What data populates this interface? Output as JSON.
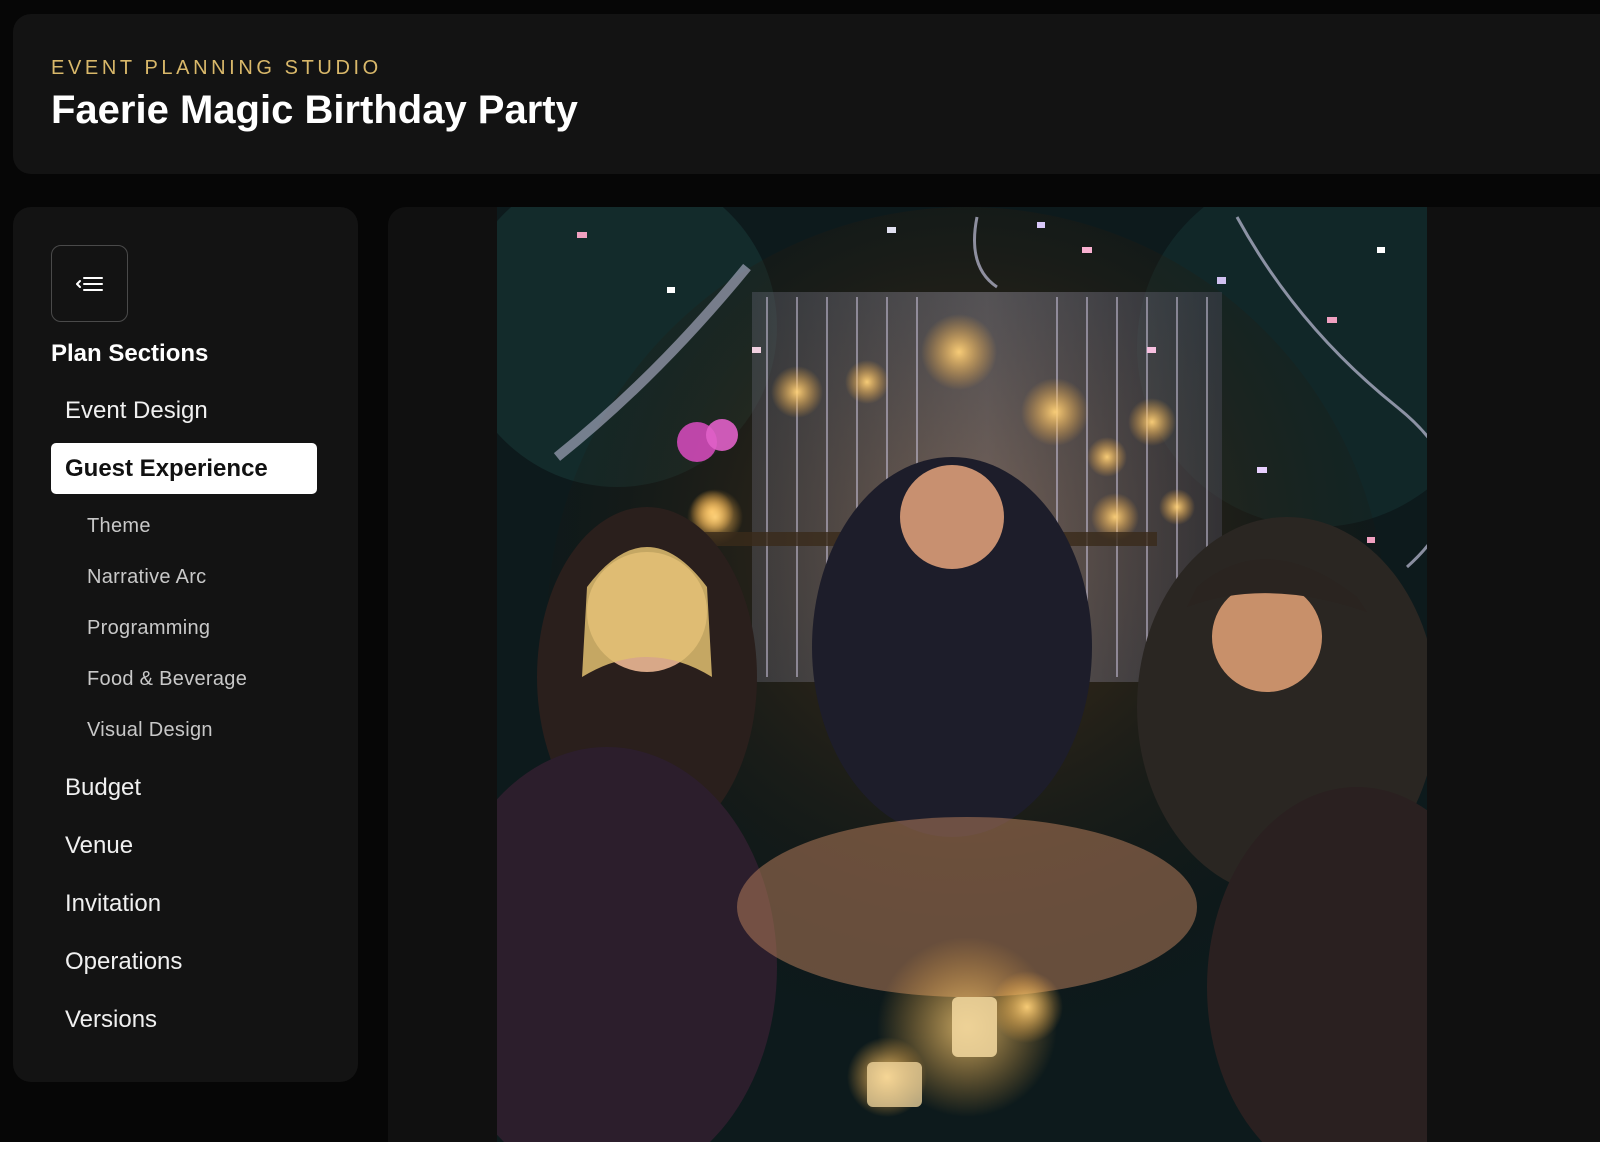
{
  "header": {
    "eyebrow": "EVENT PLANNING STUDIO",
    "title": "Faerie Magic Birthday Party"
  },
  "sidebar": {
    "toggle_icon": "collapse-menu-icon",
    "title": "Plan Sections",
    "items": [
      {
        "label": "Event Design",
        "active": false
      },
      {
        "label": "Guest Experience",
        "active": true,
        "subitems": [
          "Theme",
          "Narrative Arc",
          "Programming",
          "Food & Beverage",
          "Visual Design"
        ]
      },
      {
        "label": "Budget",
        "active": false
      },
      {
        "label": "Venue",
        "active": false
      },
      {
        "label": "Invitation",
        "active": false
      },
      {
        "label": "Operations",
        "active": false
      },
      {
        "label": "Versions",
        "active": false
      }
    ]
  },
  "main": {
    "image_alt": "Guests in a circle at a night faerie party with candles, sparkle curtain and confetti"
  },
  "colors": {
    "accent": "#d9b86a",
    "background": "#060606",
    "panel": "#131313",
    "active_item": "#ffffff"
  }
}
